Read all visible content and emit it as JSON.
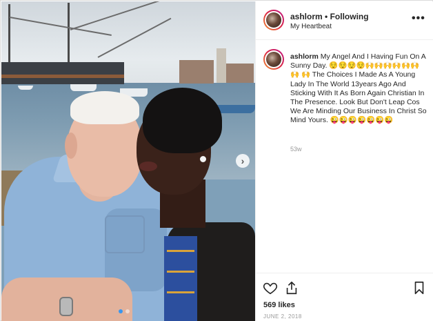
{
  "post": {
    "username": "ashlorm",
    "separator": "•",
    "follow_status": "Following",
    "location": "My Heartbeat",
    "more_label": "•••",
    "caption_user": "ashlorm",
    "caption_text": "My Angel And I Having Fun On A Sunny Day. 😌😌😌😌🙌🙌🙌🙌🙌🙌🙌 🙌 The Choices I Made As A Young Lady In The World 13years Ago And Sticking With It As Born Again Christian In The Presence. Look But Don't Leap Cos We Are Minding Our Business In Christ So Mind Yours. 😜😜😜😜😜😜😜",
    "time_ago": "53w",
    "likes": "569 likes",
    "date": "JUNE 2, 2018",
    "next_arrow": "›",
    "carousel": {
      "count": 2,
      "active_index": 0
    }
  },
  "icons": {
    "like": "heart-icon",
    "share": "share-icon",
    "save": "bookmark-icon",
    "more": "more-options-icon",
    "next": "chevron-right-icon"
  },
  "colors": {
    "accent": "#3897f0",
    "text": "#262626",
    "muted": "#999999",
    "border": "#efefef"
  }
}
